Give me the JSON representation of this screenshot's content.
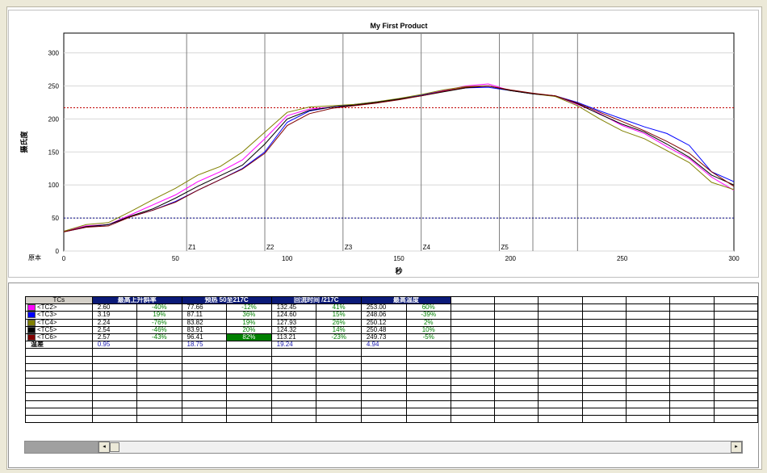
{
  "chart_data": {
    "type": "line",
    "title": "My First Product",
    "xlabel": "秒",
    "ylabel": "摄氏度",
    "origin_label": "原本",
    "xlim": [
      0,
      300
    ],
    "ylim": [
      0,
      330
    ],
    "x_ticks": [
      0,
      50,
      100,
      150,
      200,
      250,
      300
    ],
    "y_ticks": [
      0,
      50,
      100,
      150,
      200,
      250,
      300
    ],
    "zones": [
      {
        "label": "Z1",
        "x": 55
      },
      {
        "label": "Z2",
        "x": 90
      },
      {
        "label": "Z3",
        "x": 125
      },
      {
        "label": "Z4",
        "x": 160
      },
      {
        "label": "Z5",
        "x": 195
      }
    ],
    "zone_extra_lines": [
      210,
      230
    ],
    "reference_lines": [
      217,
      50
    ],
    "grid": true,
    "series": [
      {
        "name": "<TC2>",
        "color": "#ff00ff",
        "x": [
          0,
          10,
          20,
          30,
          40,
          50,
          60,
          70,
          80,
          90,
          100,
          110,
          120,
          130,
          140,
          150,
          160,
          170,
          180,
          190,
          200,
          210,
          220,
          230,
          240,
          250,
          260,
          270,
          280,
          290,
          300
        ],
        "y": [
          30,
          38,
          40,
          55,
          70,
          85,
          105,
          120,
          138,
          170,
          205,
          215,
          218,
          220,
          225,
          230,
          236,
          243,
          250,
          253,
          243,
          238,
          235,
          222,
          208,
          190,
          178,
          158,
          140,
          112,
          92
        ]
      },
      {
        "name": "<TC3>",
        "color": "#0000ff",
        "x": [
          0,
          10,
          20,
          30,
          40,
          50,
          60,
          70,
          80,
          90,
          100,
          110,
          120,
          130,
          140,
          150,
          160,
          170,
          180,
          190,
          200,
          210,
          220,
          230,
          240,
          250,
          260,
          270,
          280,
          290,
          300
        ],
        "y": [
          29,
          36,
          40,
          52,
          62,
          75,
          92,
          108,
          125,
          150,
          195,
          212,
          218,
          222,
          226,
          230,
          236,
          242,
          247,
          248,
          243,
          238,
          235,
          225,
          212,
          200,
          188,
          178,
          160,
          120,
          105
        ]
      },
      {
        "name": "<TC4>",
        "color": "#808000",
        "x": [
          0,
          10,
          20,
          30,
          40,
          50,
          60,
          70,
          80,
          90,
          100,
          110,
          120,
          130,
          140,
          150,
          160,
          170,
          180,
          190,
          200,
          210,
          220,
          230,
          240,
          250,
          260,
          270,
          280,
          290,
          300
        ],
        "y": [
          30,
          40,
          43,
          60,
          78,
          95,
          115,
          128,
          150,
          180,
          210,
          218,
          220,
          222,
          226,
          231,
          237,
          244,
          249,
          250,
          243,
          238,
          234,
          220,
          200,
          182,
          170,
          152,
          134,
          104,
          93
        ]
      },
      {
        "name": "<TC5>",
        "color": "#000000",
        "x": [
          0,
          10,
          20,
          30,
          40,
          50,
          60,
          70,
          80,
          90,
          100,
          110,
          120,
          130,
          140,
          150,
          160,
          170,
          180,
          190,
          200,
          210,
          220,
          230,
          240,
          250,
          260,
          270,
          280,
          290,
          300
        ],
        "y": [
          29,
          37,
          40,
          53,
          64,
          80,
          98,
          114,
          130,
          162,
          200,
          213,
          218,
          221,
          225,
          230,
          235,
          241,
          247,
          250,
          243,
          238,
          235,
          223,
          207,
          192,
          180,
          162,
          142,
          115,
          100
        ]
      },
      {
        "name": "<TC6>",
        "color": "#800000",
        "x": [
          0,
          10,
          20,
          30,
          40,
          50,
          60,
          70,
          80,
          90,
          100,
          110,
          120,
          130,
          140,
          150,
          160,
          170,
          180,
          190,
          200,
          210,
          220,
          230,
          240,
          250,
          260,
          270,
          280,
          290,
          300
        ],
        "y": [
          29,
          36,
          38,
          52,
          62,
          74,
          92,
          108,
          124,
          148,
          190,
          208,
          216,
          220,
          224,
          229,
          235,
          242,
          248,
          250,
          244,
          239,
          235,
          224,
          210,
          196,
          182,
          166,
          148,
          120,
          98
        ]
      }
    ]
  },
  "table": {
    "tcs_header": "TCs",
    "groups": [
      "最高上升斜率",
      "预热 50至217C",
      "回流时间 /217C",
      "最高温度"
    ],
    "rows": [
      {
        "name": "<TC2>",
        "color": "#ff00ff",
        "cells": [
          "2.60",
          "-40%",
          "77.66",
          "-12%",
          "132.45",
          "41%",
          "253.00",
          "60%"
        ]
      },
      {
        "name": "<TC3>",
        "color": "#0000ff",
        "cells": [
          "3.19",
          "19%",
          "87.11",
          "36%",
          "124.60",
          "15%",
          "248.06",
          "-39%"
        ]
      },
      {
        "name": "<TC4>",
        "color": "#808000",
        "cells": [
          "2.24",
          "-76%",
          "83.82",
          "19%",
          "127.93",
          "26%",
          "250.12",
          "2%"
        ]
      },
      {
        "name": "<TC5>",
        "color": "#000000",
        "cells": [
          "2.54",
          "-46%",
          "83.91",
          "20%",
          "124.32",
          "14%",
          "250.48",
          "10%"
        ]
      },
      {
        "name": "<TC6>",
        "color": "#800000",
        "cells": [
          "2.57",
          "-43%",
          "96.41",
          "82%",
          "113.21",
          "-23%",
          "249.73",
          "-5%"
        ]
      }
    ],
    "diff_row": {
      "label": "温差",
      "cells": [
        "0.95",
        "18.75",
        "19.24",
        "4.94"
      ]
    }
  },
  "scrollbar": {
    "left_arrow": "◂",
    "right_arrow": "▸"
  }
}
